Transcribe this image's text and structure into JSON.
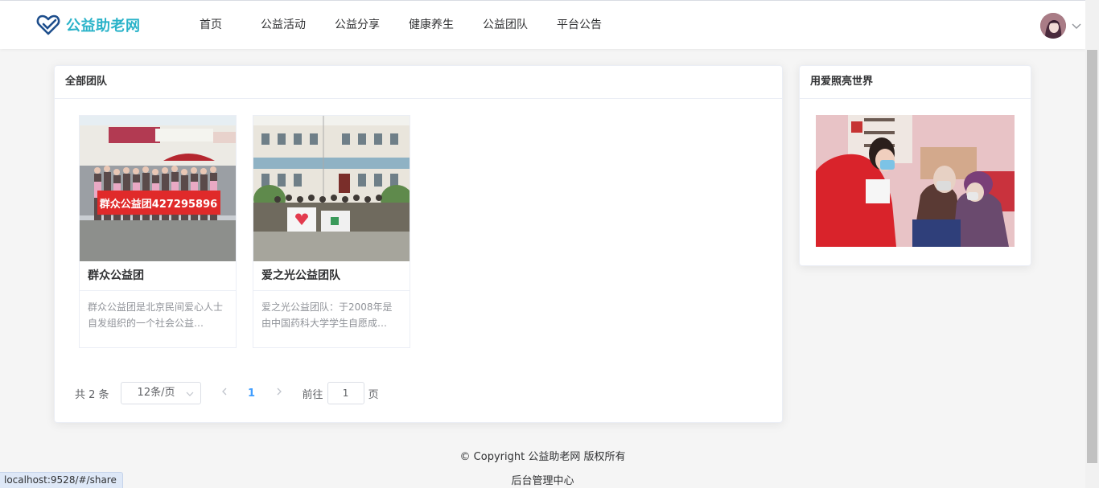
{
  "brand": {
    "logo_icon": "heart-check-icon",
    "name": "公益助老网",
    "color": "#2ab3c9"
  },
  "nav": {
    "items": [
      {
        "label": "首页"
      },
      {
        "label": "公益活动"
      },
      {
        "label": "公益分享"
      },
      {
        "label": "健康养生"
      },
      {
        "label": "公益团队"
      },
      {
        "label": "平台公告"
      }
    ]
  },
  "user": {
    "avatar_icon": "user-avatar",
    "menu_icon": "chevron-down-icon"
  },
  "main": {
    "title": "全部团队",
    "teams": [
      {
        "name": "群众公益团",
        "desc": "群众公益团是北京民间爱心人士自发组织的一个社会公益…"
      },
      {
        "name": "爱之光公益团队",
        "desc": "爱之光公益团队：于2008年是由中国药科大学学生自愿成…"
      }
    ],
    "pagination": {
      "total_text": "共 2 条",
      "page_size": "12条/页",
      "current_page": "1",
      "goto_label": "前往",
      "goto_value": "1",
      "page_suffix": "页"
    }
  },
  "side": {
    "title": "用爱照亮世界"
  },
  "footer": {
    "copyright": "© Copyright 公益助老网 版权所有",
    "admin": "后台管理中心"
  },
  "status_url": "localhost:9528/#/share",
  "colors": {
    "accent": "#409eff",
    "brand": "#2ab3c9",
    "banner_red": "#e02a2a"
  }
}
